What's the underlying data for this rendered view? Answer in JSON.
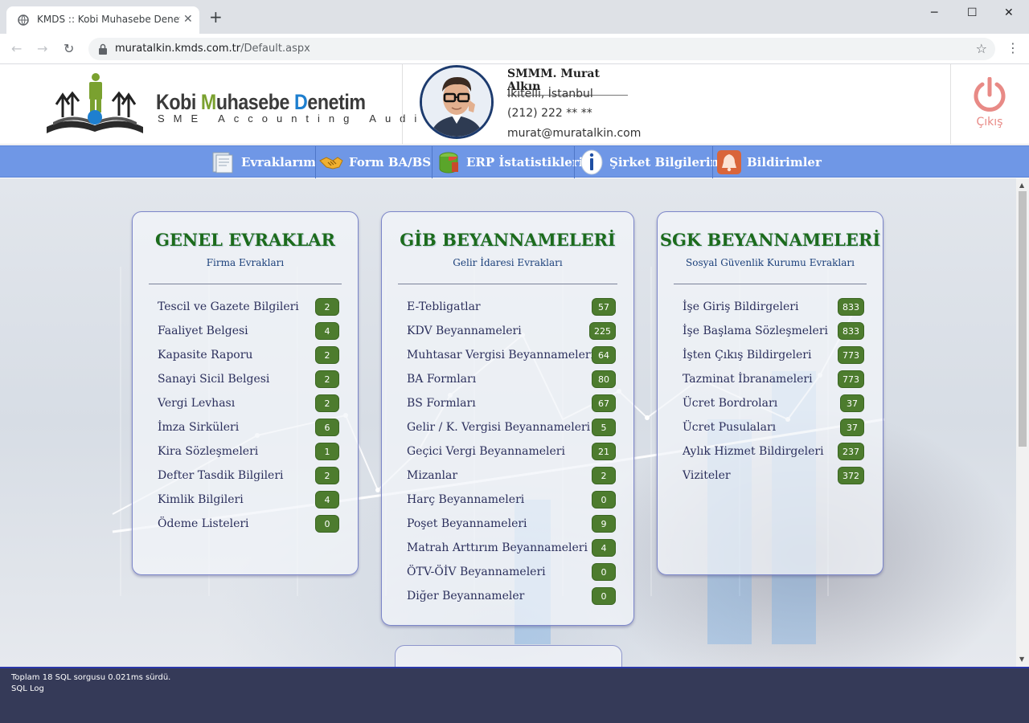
{
  "browser": {
    "tab_title": "KMDS :: Kobi Muhasebe Denetim",
    "new_tab": "+",
    "url_host": "muratalkin.kmds.com.tr",
    "url_path": "/Default.aspx",
    "window_controls": {
      "minimize": "─",
      "maximize": "☐",
      "close": "✕"
    }
  },
  "header": {
    "logo_text_part1": "Kobi ",
    "logo_text_m": "M",
    "logo_text_part2": "uhasebe ",
    "logo_text_d": "D",
    "logo_text_part3": "enetim",
    "logo_subtitle": "SME Accounting Audit",
    "user": {
      "name": "SMMM. Murat Alkın",
      "location": "İkitelli, İstanbul",
      "phone": "(212) 222 ** **",
      "email": "murat@muratalkin.com"
    },
    "logout_label": "Çıkış"
  },
  "nav": {
    "items": [
      {
        "label": "Evraklarım",
        "icon": "folder-icon"
      },
      {
        "label": "Form BA/BS",
        "icon": "handshake-icon"
      },
      {
        "label": "ERP İstatistikleri",
        "icon": "stats-icon"
      },
      {
        "label": "Şirket Bilgilerim",
        "icon": "info-icon"
      },
      {
        "label": "Bildirimler",
        "icon": "bell-icon"
      }
    ]
  },
  "panels": [
    {
      "title": "GENEL EVRAKLAR",
      "subtitle": "Firma Evrakları",
      "items": [
        {
          "label": "Tescil ve Gazete Bilgileri",
          "count": "2"
        },
        {
          "label": "Faaliyet Belgesi",
          "count": "4"
        },
        {
          "label": "Kapasite Raporu",
          "count": "2"
        },
        {
          "label": "Sanayi Sicil Belgesi",
          "count": "2"
        },
        {
          "label": "Vergi Levhası",
          "count": "2"
        },
        {
          "label": "İmza Sirküleri",
          "count": "6"
        },
        {
          "label": "Kira Sözleşmeleri",
          "count": "1"
        },
        {
          "label": "Defter Tasdik Bilgileri",
          "count": "2"
        },
        {
          "label": "Kimlik Bilgileri",
          "count": "4"
        },
        {
          "label": "Ödeme Listeleri",
          "count": "0"
        }
      ]
    },
    {
      "title": "GİB BEYANNAMELERİ",
      "subtitle": "Gelir İdaresi Evrakları",
      "items": [
        {
          "label": "E-Tebligatlar",
          "count": "57"
        },
        {
          "label": "KDV Beyannameleri",
          "count": "225"
        },
        {
          "label": "Muhtasar Vergisi Beyannameleri",
          "count": "64"
        },
        {
          "label": "BA Formları",
          "count": "80"
        },
        {
          "label": "BS Formları",
          "count": "67"
        },
        {
          "label": "Gelir / K. Vergisi Beyannameleri",
          "count": "5"
        },
        {
          "label": "Geçici Vergi Beyannameleri",
          "count": "21"
        },
        {
          "label": "Mizanlar",
          "count": "2"
        },
        {
          "label": "Harç Beyannameleri",
          "count": "0"
        },
        {
          "label": "Poşet Beyannameleri",
          "count": "9"
        },
        {
          "label": "Matrah Arttırım Beyannameleri",
          "count": "4"
        },
        {
          "label": "ÖTV-ÖİV Beyannameleri",
          "count": "0"
        },
        {
          "label": "Diğer Beyannameler",
          "count": "0"
        }
      ]
    },
    {
      "title": "SGK BEYANNAMELERİ",
      "subtitle": "Sosyal Güvenlik Kurumu Evrakları",
      "items": [
        {
          "label": "İşe Giriş Bildirgeleri",
          "count": "833"
        },
        {
          "label": "İşe Başlama Sözleşmeleri",
          "count": "833"
        },
        {
          "label": "İşten Çıkış Bildirgeleri",
          "count": "773"
        },
        {
          "label": "Tazminat İbranameleri",
          "count": "773"
        },
        {
          "label": "Ücret Bordroları",
          "count": "37"
        },
        {
          "label": "Ücret Pusulaları",
          "count": "37"
        },
        {
          "label": "Aylık Hizmet Bildirgeleri",
          "count": "237"
        },
        {
          "label": "Viziteler",
          "count": "372"
        }
      ]
    }
  ],
  "footer": {
    "sql_summary": "Toplam 18 SQL sorgusu 0.021ms sürdü.",
    "sql_log_link": "SQL Log"
  },
  "colors": {
    "nav_bg": "#6f97e6",
    "title_green": "#1c6b1c",
    "badge_green": "#4d7c2e",
    "footer_bg": "#353a58",
    "logout_red": "#e88a86"
  }
}
